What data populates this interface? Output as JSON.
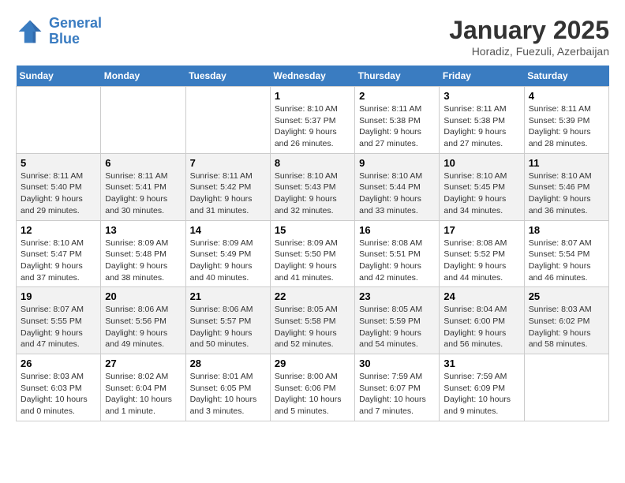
{
  "header": {
    "logo_line1": "General",
    "logo_line2": "Blue",
    "title": "January 2025",
    "subtitle": "Horadiz, Fuezuli, Azerbaijan"
  },
  "days_of_week": [
    "Sunday",
    "Monday",
    "Tuesday",
    "Wednesday",
    "Thursday",
    "Friday",
    "Saturday"
  ],
  "weeks": [
    [
      {
        "num": "",
        "info": ""
      },
      {
        "num": "",
        "info": ""
      },
      {
        "num": "",
        "info": ""
      },
      {
        "num": "1",
        "info": "Sunrise: 8:10 AM\nSunset: 5:37 PM\nDaylight: 9 hours and 26 minutes."
      },
      {
        "num": "2",
        "info": "Sunrise: 8:11 AM\nSunset: 5:38 PM\nDaylight: 9 hours and 27 minutes."
      },
      {
        "num": "3",
        "info": "Sunrise: 8:11 AM\nSunset: 5:38 PM\nDaylight: 9 hours and 27 minutes."
      },
      {
        "num": "4",
        "info": "Sunrise: 8:11 AM\nSunset: 5:39 PM\nDaylight: 9 hours and 28 minutes."
      }
    ],
    [
      {
        "num": "5",
        "info": "Sunrise: 8:11 AM\nSunset: 5:40 PM\nDaylight: 9 hours and 29 minutes."
      },
      {
        "num": "6",
        "info": "Sunrise: 8:11 AM\nSunset: 5:41 PM\nDaylight: 9 hours and 30 minutes."
      },
      {
        "num": "7",
        "info": "Sunrise: 8:11 AM\nSunset: 5:42 PM\nDaylight: 9 hours and 31 minutes."
      },
      {
        "num": "8",
        "info": "Sunrise: 8:10 AM\nSunset: 5:43 PM\nDaylight: 9 hours and 32 minutes."
      },
      {
        "num": "9",
        "info": "Sunrise: 8:10 AM\nSunset: 5:44 PM\nDaylight: 9 hours and 33 minutes."
      },
      {
        "num": "10",
        "info": "Sunrise: 8:10 AM\nSunset: 5:45 PM\nDaylight: 9 hours and 34 minutes."
      },
      {
        "num": "11",
        "info": "Sunrise: 8:10 AM\nSunset: 5:46 PM\nDaylight: 9 hours and 36 minutes."
      }
    ],
    [
      {
        "num": "12",
        "info": "Sunrise: 8:10 AM\nSunset: 5:47 PM\nDaylight: 9 hours and 37 minutes."
      },
      {
        "num": "13",
        "info": "Sunrise: 8:09 AM\nSunset: 5:48 PM\nDaylight: 9 hours and 38 minutes."
      },
      {
        "num": "14",
        "info": "Sunrise: 8:09 AM\nSunset: 5:49 PM\nDaylight: 9 hours and 40 minutes."
      },
      {
        "num": "15",
        "info": "Sunrise: 8:09 AM\nSunset: 5:50 PM\nDaylight: 9 hours and 41 minutes."
      },
      {
        "num": "16",
        "info": "Sunrise: 8:08 AM\nSunset: 5:51 PM\nDaylight: 9 hours and 42 minutes."
      },
      {
        "num": "17",
        "info": "Sunrise: 8:08 AM\nSunset: 5:52 PM\nDaylight: 9 hours and 44 minutes."
      },
      {
        "num": "18",
        "info": "Sunrise: 8:07 AM\nSunset: 5:54 PM\nDaylight: 9 hours and 46 minutes."
      }
    ],
    [
      {
        "num": "19",
        "info": "Sunrise: 8:07 AM\nSunset: 5:55 PM\nDaylight: 9 hours and 47 minutes."
      },
      {
        "num": "20",
        "info": "Sunrise: 8:06 AM\nSunset: 5:56 PM\nDaylight: 9 hours and 49 minutes."
      },
      {
        "num": "21",
        "info": "Sunrise: 8:06 AM\nSunset: 5:57 PM\nDaylight: 9 hours and 50 minutes."
      },
      {
        "num": "22",
        "info": "Sunrise: 8:05 AM\nSunset: 5:58 PM\nDaylight: 9 hours and 52 minutes."
      },
      {
        "num": "23",
        "info": "Sunrise: 8:05 AM\nSunset: 5:59 PM\nDaylight: 9 hours and 54 minutes."
      },
      {
        "num": "24",
        "info": "Sunrise: 8:04 AM\nSunset: 6:00 PM\nDaylight: 9 hours and 56 minutes."
      },
      {
        "num": "25",
        "info": "Sunrise: 8:03 AM\nSunset: 6:02 PM\nDaylight: 9 hours and 58 minutes."
      }
    ],
    [
      {
        "num": "26",
        "info": "Sunrise: 8:03 AM\nSunset: 6:03 PM\nDaylight: 10 hours and 0 minutes."
      },
      {
        "num": "27",
        "info": "Sunrise: 8:02 AM\nSunset: 6:04 PM\nDaylight: 10 hours and 1 minute."
      },
      {
        "num": "28",
        "info": "Sunrise: 8:01 AM\nSunset: 6:05 PM\nDaylight: 10 hours and 3 minutes."
      },
      {
        "num": "29",
        "info": "Sunrise: 8:00 AM\nSunset: 6:06 PM\nDaylight: 10 hours and 5 minutes."
      },
      {
        "num": "30",
        "info": "Sunrise: 7:59 AM\nSunset: 6:07 PM\nDaylight: 10 hours and 7 minutes."
      },
      {
        "num": "31",
        "info": "Sunrise: 7:59 AM\nSunset: 6:09 PM\nDaylight: 10 hours and 9 minutes."
      },
      {
        "num": "",
        "info": ""
      }
    ]
  ]
}
